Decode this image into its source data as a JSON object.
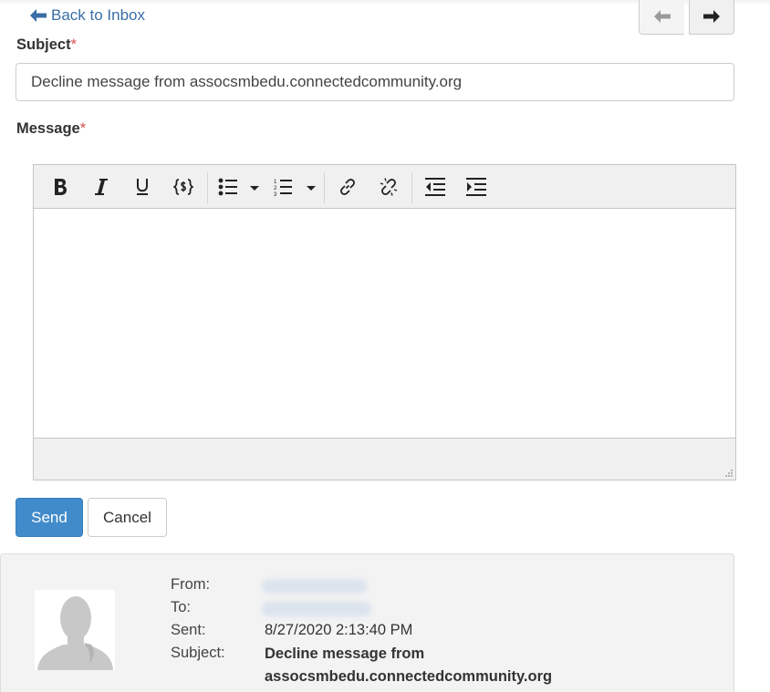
{
  "nav": {
    "back_label": "Back to Inbox",
    "prev_icon": "arrow-left-icon",
    "next_icon": "arrow-right-icon"
  },
  "form": {
    "subject_label": "Subject",
    "subject_value": "Decline message from assocsmbedu.connectedcommunity.org",
    "message_label": "Message",
    "required_mark": "*"
  },
  "editor": {
    "toolbar": [
      {
        "name": "bold-button",
        "icon": "bold-icon"
      },
      {
        "name": "italic-button",
        "icon": "italic-icon"
      },
      {
        "name": "underline-button",
        "icon": "underline-icon"
      },
      {
        "name": "insert-field-button",
        "icon": "curly-braces-icon"
      },
      {
        "name": "bullet-list-button",
        "icon": "bullet-list-icon"
      },
      {
        "name": "numbered-list-button",
        "icon": "numbered-list-icon"
      },
      {
        "name": "insert-link-button",
        "icon": "link-icon"
      },
      {
        "name": "remove-link-button",
        "icon": "unlink-icon"
      },
      {
        "name": "outdent-button",
        "icon": "outdent-icon"
      },
      {
        "name": "indent-button",
        "icon": "indent-icon"
      }
    ],
    "body": ""
  },
  "actions": {
    "send_label": "Send",
    "cancel_label": "Cancel"
  },
  "original_message": {
    "from_label": "From:",
    "to_label": "To:",
    "sent_label": "Sent:",
    "subject_label": "Subject:",
    "sent_value": "8/27/2020 2:13:40 PM",
    "subject_value": "Decline message from assocsmbedu.connectedcommunity.org",
    "avatar_icon": "default-avatar-icon"
  },
  "colors": {
    "link": "#3a6ea5",
    "primary": "#428bca",
    "required": "#d9534f",
    "panel_bg": "#f3f3f3"
  }
}
